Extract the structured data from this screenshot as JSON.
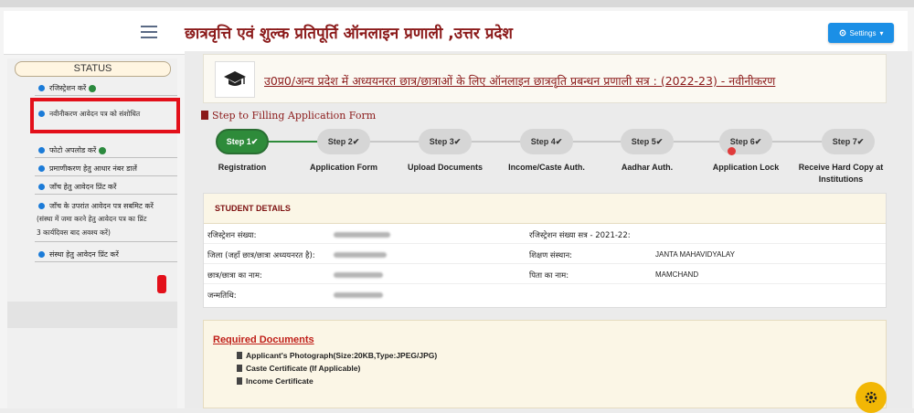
{
  "header": {
    "title": "छात्रवृत्ति एवं शुल्क प्रतिपूर्ति ऑनलाइन प्रणाली ,उत्तर प्रदेश",
    "settings_label": "Settings"
  },
  "sidebar": {
    "status_label": "STATUS",
    "items": [
      {
        "label": "रजिस्ट्रेशन करें"
      },
      {
        "label": "नवीनीकरण आवेदन पत्र को संशोधित"
      },
      {
        "label": "फोटो अपलोड करें"
      },
      {
        "label": "प्रमाणीकरण हेतु आधार नंबर डालें"
      },
      {
        "label": "जाँच हेतु आवेदन प्रिंट करें"
      },
      {
        "label": "जाँच के उपरांत आवेदन पत्र सबमिट करें"
      },
      {
        "label": "संस्था हेतु आवेदन प्रिंट करें"
      }
    ],
    "note_lines": [
      "(संस्था में जमा करने हेतु आवेदन पत्र का प्रिंट",
      "3 कार्यदिवस बाद अवश्य करें)"
    ]
  },
  "banner": {
    "title": "उ0प्र0/अन्य प्रदेश में अध्ययनरत छात्र/छात्राओं के लिए ऑनलाइन छात्रवृति प्रबन्धन प्रणाली सत्र : (2022-23) - नवीनीकरण"
  },
  "steps": {
    "heading": "Step to Filling Application Form",
    "items": [
      {
        "pill": "Step 1",
        "label": "Registration"
      },
      {
        "pill": "Step 2",
        "label": "Application Form"
      },
      {
        "pill": "Step 3",
        "label": "Upload Documents"
      },
      {
        "pill": "Step 4",
        "label": "Income/Caste Auth."
      },
      {
        "pill": "Step 5",
        "label": "Aadhar Auth."
      },
      {
        "pill": "Step 6",
        "label": "Application Lock"
      },
      {
        "pill": "Step 7",
        "label": "Receive Hard Copy at Institutions"
      }
    ]
  },
  "student": {
    "heading": "STUDENT DETAILS",
    "rows": [
      {
        "label_left": "रजिस्ट्रेशन संख्या:",
        "value_left": "",
        "label_right": "रजिस्ट्रेशन संख्या सत्र - 2021-22:",
        "value_right": ""
      },
      {
        "label_left": "जिला (जहाँ छात्र/छात्रा अध्ययनरत है):",
        "value_left": "",
        "label_right": "शिक्षण संस्थान:",
        "value_right": "JANTA MAHAVIDYALAY"
      },
      {
        "label_left": "छात्र/छात्रा का नाम:",
        "value_left": "",
        "label_right": "पिता का नाम:",
        "value_right": "MAMCHAND"
      },
      {
        "label_left": "जन्मतिथि:",
        "value_left": "",
        "label_right": "",
        "value_right": ""
      }
    ]
  },
  "documents": {
    "title": "Required Documents",
    "items": [
      "Applicant's Photograph(Size:20KB,Type:JPEG/JPG)",
      "Caste Certificate (If Applicable)",
      "Income Certificate"
    ]
  },
  "colors": {
    "title_maroon": "#8b1a1a",
    "step_done_green": "#2e8b3a",
    "highlight_red": "#e3101a",
    "settings_blue": "#1b8fe6"
  }
}
